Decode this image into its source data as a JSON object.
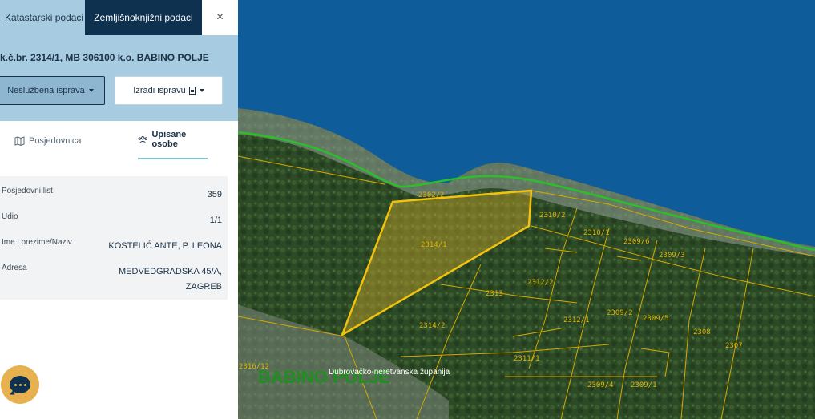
{
  "tabs": {
    "katastarski": "Katastarski podaci",
    "zemljisnoknjizni": "Zemljišnoknjižni podaci",
    "close_icon": "×"
  },
  "parcel_title": "k.č.br. 2314/1, MB 306100 k.o. BABINO POLJE",
  "buttons": {
    "neusluzbena": "Neslužbena isprava",
    "izradi": "Izradi ispravu"
  },
  "subtabs": {
    "posjedovnica": "Posjedovnica",
    "upisane_osobe": "Upisane osobe"
  },
  "info": {
    "rows": [
      {
        "label": "Posjedovni list",
        "value": "359"
      },
      {
        "label": "Udio",
        "value": "1/1"
      },
      {
        "label": "Ime i prezime/Naziv",
        "value": "KOSTELIĆ ANTE, P. LEONA"
      },
      {
        "label": "Adresa",
        "value": "MEDVEDGRADSKA 45/A, ZAGREB"
      }
    ]
  },
  "map": {
    "parcel_labels": [
      "2302/2",
      "2310/2",
      "2310/1",
      "2309/6",
      "2309/3",
      "2314/1",
      "2312/2",
      "2313",
      "2312/1",
      "2309/2",
      "2309/5",
      "2314/2",
      "2308",
      "2307",
      "2311/1",
      "2309/4",
      "2309/1",
      "2316/12"
    ],
    "place_name": "BABINO POLJE",
    "county_name": "Dubrovačko-neretvanska županija"
  },
  "colors": {
    "sea": "#0f5c9a",
    "panel_header": "#a7cbe0",
    "active_tab": "#0e3150",
    "parcel_outline": "#e8b300",
    "border_line": "#2bbf2b",
    "chat": "#e6b14e"
  },
  "icons": {
    "posjedovnica": "map-icon",
    "upisane_osobe": "users-icon",
    "chat": "chat-icon"
  }
}
